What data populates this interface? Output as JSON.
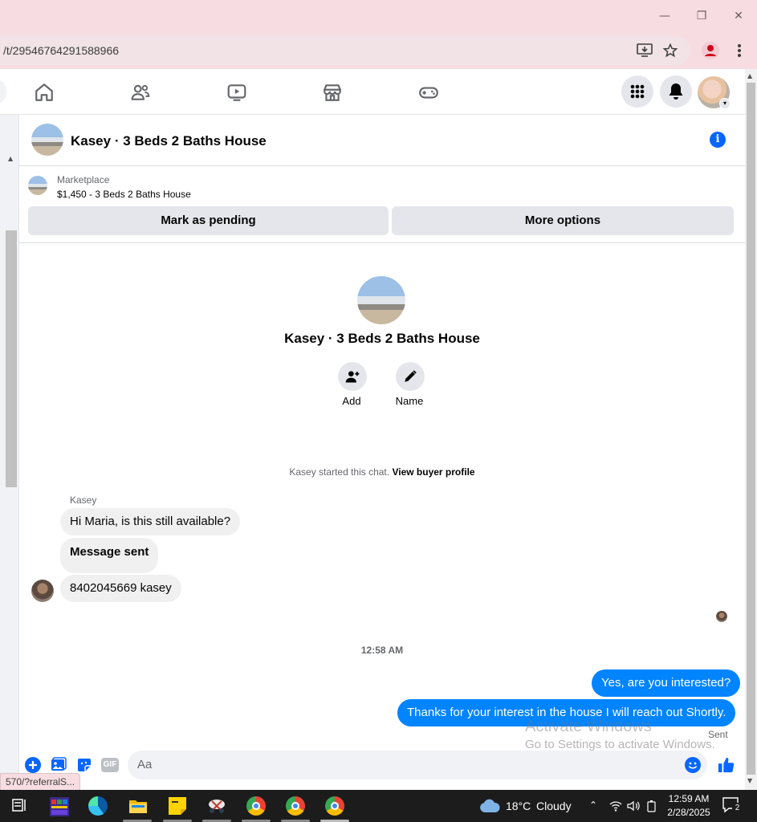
{
  "browser": {
    "url": "/t/29546764291588966",
    "win_minimize": "—",
    "win_restore": "❐",
    "win_close": "✕",
    "status_url": "570/?referralS..."
  },
  "chat": {
    "title": "Kasey · 3 Beds 2 Baths House",
    "info_icon": "i"
  },
  "marketplace": {
    "label": "Marketplace",
    "listing": "$1,450 - 3 Beds 2 Baths House",
    "mark_pending": "Mark as pending",
    "more_options": "More options"
  },
  "profile": {
    "name": "Kasey · 3 Beds 2 Baths House",
    "add_label": "Add",
    "name_label": "Name"
  },
  "conversation": {
    "started_prefix": "Kasey started this chat.",
    "view_buyer": "View buyer profile",
    "sender": "Kasey",
    "incoming": [
      "Hi Maria, is this still available?",
      "Message sent",
      "8402045669 kasey"
    ],
    "timestamp": "12:58 AM",
    "outgoing": [
      "Yes, are you interested?",
      "Thanks for your interest in the house I will reach out Shortly."
    ],
    "sent": "Sent"
  },
  "composer": {
    "placeholder": "Aa",
    "gif_label": "GIF"
  },
  "watermark": {
    "line1": "Activate Windows",
    "line2": "Go to Settings to activate Windows."
  },
  "taskbar": {
    "weather": "18°C",
    "condition": "Cloudy",
    "time": "12:59 AM",
    "date": "2/28/2025",
    "notifications": "2"
  },
  "colors": {
    "accent_blue": "#0866ff",
    "outgoing_bubble": "#0084ff",
    "browser_chrome": "#f7dde2"
  }
}
